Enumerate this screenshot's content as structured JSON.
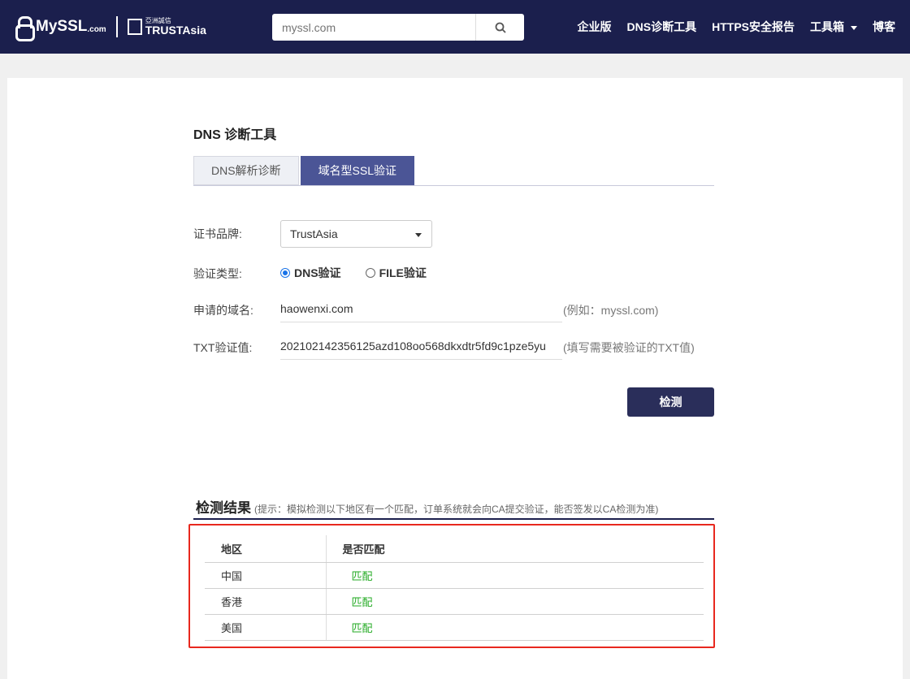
{
  "nav": {
    "logo_text": "MySSL",
    "logo_com": ".com",
    "logo2_cn": "亞洲誠信",
    "logo2_en": "TRUSTAsia",
    "search_placeholder": "myssl.com",
    "menu": [
      "企业版",
      "DNS诊断工具",
      "HTTPS安全报告",
      "工具箱",
      "博客"
    ]
  },
  "page": {
    "title": "DNS 诊断工具",
    "tabs": [
      "DNS解析诊断",
      "域名型SSL验证"
    ]
  },
  "form": {
    "brand_label": "证书品牌:",
    "brand_value": "TrustAsia",
    "type_label": "验证类型:",
    "type_options": [
      "DNS验证",
      "FILE验证"
    ],
    "domain_label": "申请的域名:",
    "domain_value": "haowenxi.com",
    "domain_hint": "(例如：myssl.com)",
    "txt_label": "TXT验证值:",
    "txt_value": "202102142356125azd108oo568dkxdtr5fd9c1pze5yu",
    "txt_hint": "(填写需要被验证的TXT值)",
    "check_button": "检测"
  },
  "results": {
    "title": "检测结果",
    "note": "(提示：模拟检测以下地区有一个匹配，订单系统就会向CA提交验证，能否签发以CA检测为准)",
    "headers": [
      "地区",
      "是否匹配"
    ],
    "rows": [
      [
        "中国",
        "匹配"
      ],
      [
        "香港",
        "匹配"
      ],
      [
        "美国",
        "匹配"
      ]
    ]
  },
  "colors": {
    "nav_bg": "#1b1f4d",
    "accent": "#4b5596",
    "match": "#22aa22",
    "highlight": "#e8281e"
  }
}
